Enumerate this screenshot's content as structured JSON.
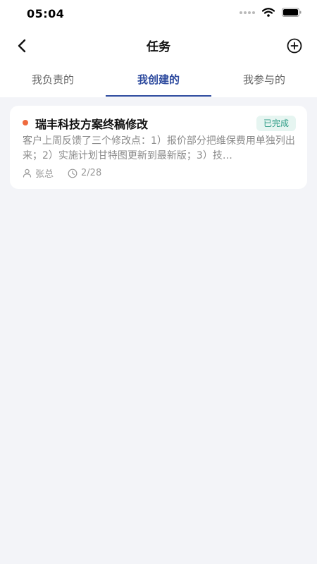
{
  "status_bar": {
    "time": "05:04"
  },
  "nav": {
    "title": "任务",
    "back_icon": "chevron-left-icon",
    "add_icon": "plus-circle-icon"
  },
  "tabs": [
    {
      "label": "我负责的",
      "active": false
    },
    {
      "label": "我创建的",
      "active": true
    },
    {
      "label": "我参与的",
      "active": false
    }
  ],
  "tasks": [
    {
      "title": "瑞丰科技方案终稿修改",
      "status": "已完成",
      "description": "客户上周反馈了三个修改点：1）报价部分把维保费用单独列出来；2）实施计划甘特图更新到最新版；3）技…",
      "assignee": "张总",
      "due": "2/28"
    }
  ],
  "colors": {
    "accent": "#2d4a9e",
    "priority_dot": "#ef6a3e",
    "status_text": "#2e9c86",
    "status_bg": "#e6f5f1",
    "page_bg": "#f3f4f8"
  }
}
